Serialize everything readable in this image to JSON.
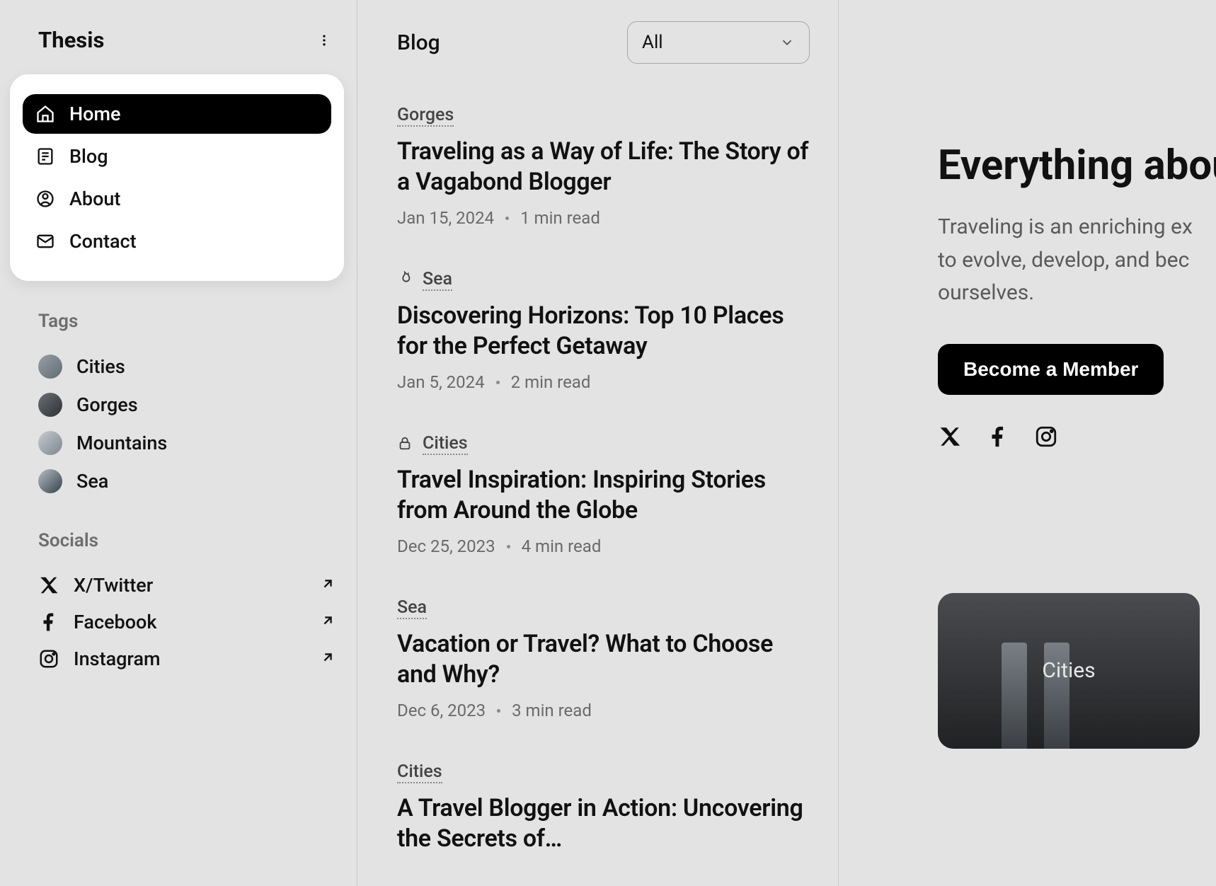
{
  "site": {
    "title": "Thesis"
  },
  "nav": {
    "items": [
      {
        "label": "Home",
        "icon": "home",
        "active": true
      },
      {
        "label": "Blog",
        "icon": "blog",
        "active": false
      },
      {
        "label": "About",
        "icon": "about",
        "active": false
      },
      {
        "label": "Contact",
        "icon": "contact",
        "active": false
      }
    ]
  },
  "tags": {
    "heading": "Tags",
    "items": [
      {
        "label": "Cities"
      },
      {
        "label": "Gorges"
      },
      {
        "label": "Mountains"
      },
      {
        "label": "Sea"
      }
    ]
  },
  "socials": {
    "heading": "Socials",
    "items": [
      {
        "label": "X/Twitter",
        "icon": "x"
      },
      {
        "label": "Facebook",
        "icon": "facebook"
      },
      {
        "label": "Instagram",
        "icon": "instagram"
      }
    ]
  },
  "blog": {
    "title": "Blog",
    "filter_selected": "All",
    "posts": [
      {
        "tag": "Gorges",
        "icon": null,
        "title": "Traveling as a Way of Life: The Story of a Vagabond Blogger",
        "date": "Jan 15, 2024",
        "read": "1 min read"
      },
      {
        "tag": "Sea",
        "icon": "flame",
        "title": "Discovering Horizons: Top 10 Places for the Perfect Getaway",
        "date": "Jan 5, 2024",
        "read": "2 min read"
      },
      {
        "tag": "Cities",
        "icon": "lock",
        "title": "Travel Inspiration: Inspiring Stories from Around the Globe",
        "date": "Dec 25, 2023",
        "read": "4 min read"
      },
      {
        "tag": "Sea",
        "icon": null,
        "title": "Vacation or Travel? What to Choose and Why?",
        "date": "Dec 6, 2023",
        "read": "3 min read"
      },
      {
        "tag": "Cities",
        "icon": null,
        "title": "A Travel Blogger in Action: Uncovering the Secrets of…",
        "date": "",
        "read": ""
      }
    ]
  },
  "hero": {
    "heading": "Everything abou",
    "sub_lines": [
      "Traveling is an enriching ex",
      "to evolve, develop, and bec",
      "ourselves."
    ],
    "cta": "Become a Member",
    "featured_label": "Cities"
  }
}
